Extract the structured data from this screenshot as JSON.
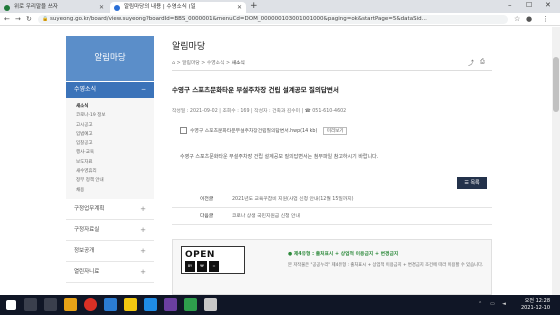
{
  "browser": {
    "tabs": [
      {
        "title": "위로 우리말을 쓰자"
      },
      {
        "title": "알림마당의 내용 | 수영소식 (일"
      }
    ],
    "url": "suyeong.go.kr/board/view.suyeong?boardId=BBS_0000001&menuCd=DOM_000000103001001000&paging=ok&startPage=5&dataSid..."
  },
  "sidebar": {
    "title": "알림마당",
    "active_section": "수영소식",
    "subitems": [
      "새소식",
      "코로나-19 정보",
      "고시공고",
      "입법예고",
      "입찰공고",
      "행사·교육",
      "보도자료",
      "새수영휴리",
      "정부 정책 안내",
      "채용"
    ],
    "sections": [
      "구정업무계획",
      "구정자료실",
      "정보공개",
      "열린자니료"
    ]
  },
  "content": {
    "page_title": "알림마당",
    "breadcrumb": [
      "알림마당",
      "수영소식",
      "새소식"
    ],
    "post_title": "수영구 스포츠문화타운 부설주차장 건립 설계공모 질의답변서",
    "meta": "작성일 : 2021-09-02   |   조회수 : 169   |   작성자 : 건축과 김수미   |   ☎ 051-610-4602",
    "attachment": "수영구 스포츠문화타운부설주차장건립질의답변서.hwp(14 kb)",
    "preview_label": "미리보기",
    "body": "수영구 스포츠문화타운 부설주차장 건립 설계공모 질의답변서는 첨부파일 참고하시기 바랍니다.",
    "list_button": "목록",
    "prev_label": "이전글",
    "prev_text": "2021년도 교육꾸잡비 지원(사업 신청 안내(12월 15일까지)",
    "next_label": "다음글",
    "next_text": "코로나 상생 국민지원금 신청 안내"
  },
  "kogl": {
    "logo_text": "OPEN",
    "type": "제4유형 : 출처표시 + 상업적 이용금지 + 변경금지",
    "desc": "본 저작물은 \"공공누리\" 제4유형 : 출처표시 + 상업적 이용금지 + 변경금지 조건에 따라 이용할 수 있습니다."
  },
  "taskbar": {
    "time": "오전 12:28",
    "date": "2021-12-10"
  }
}
